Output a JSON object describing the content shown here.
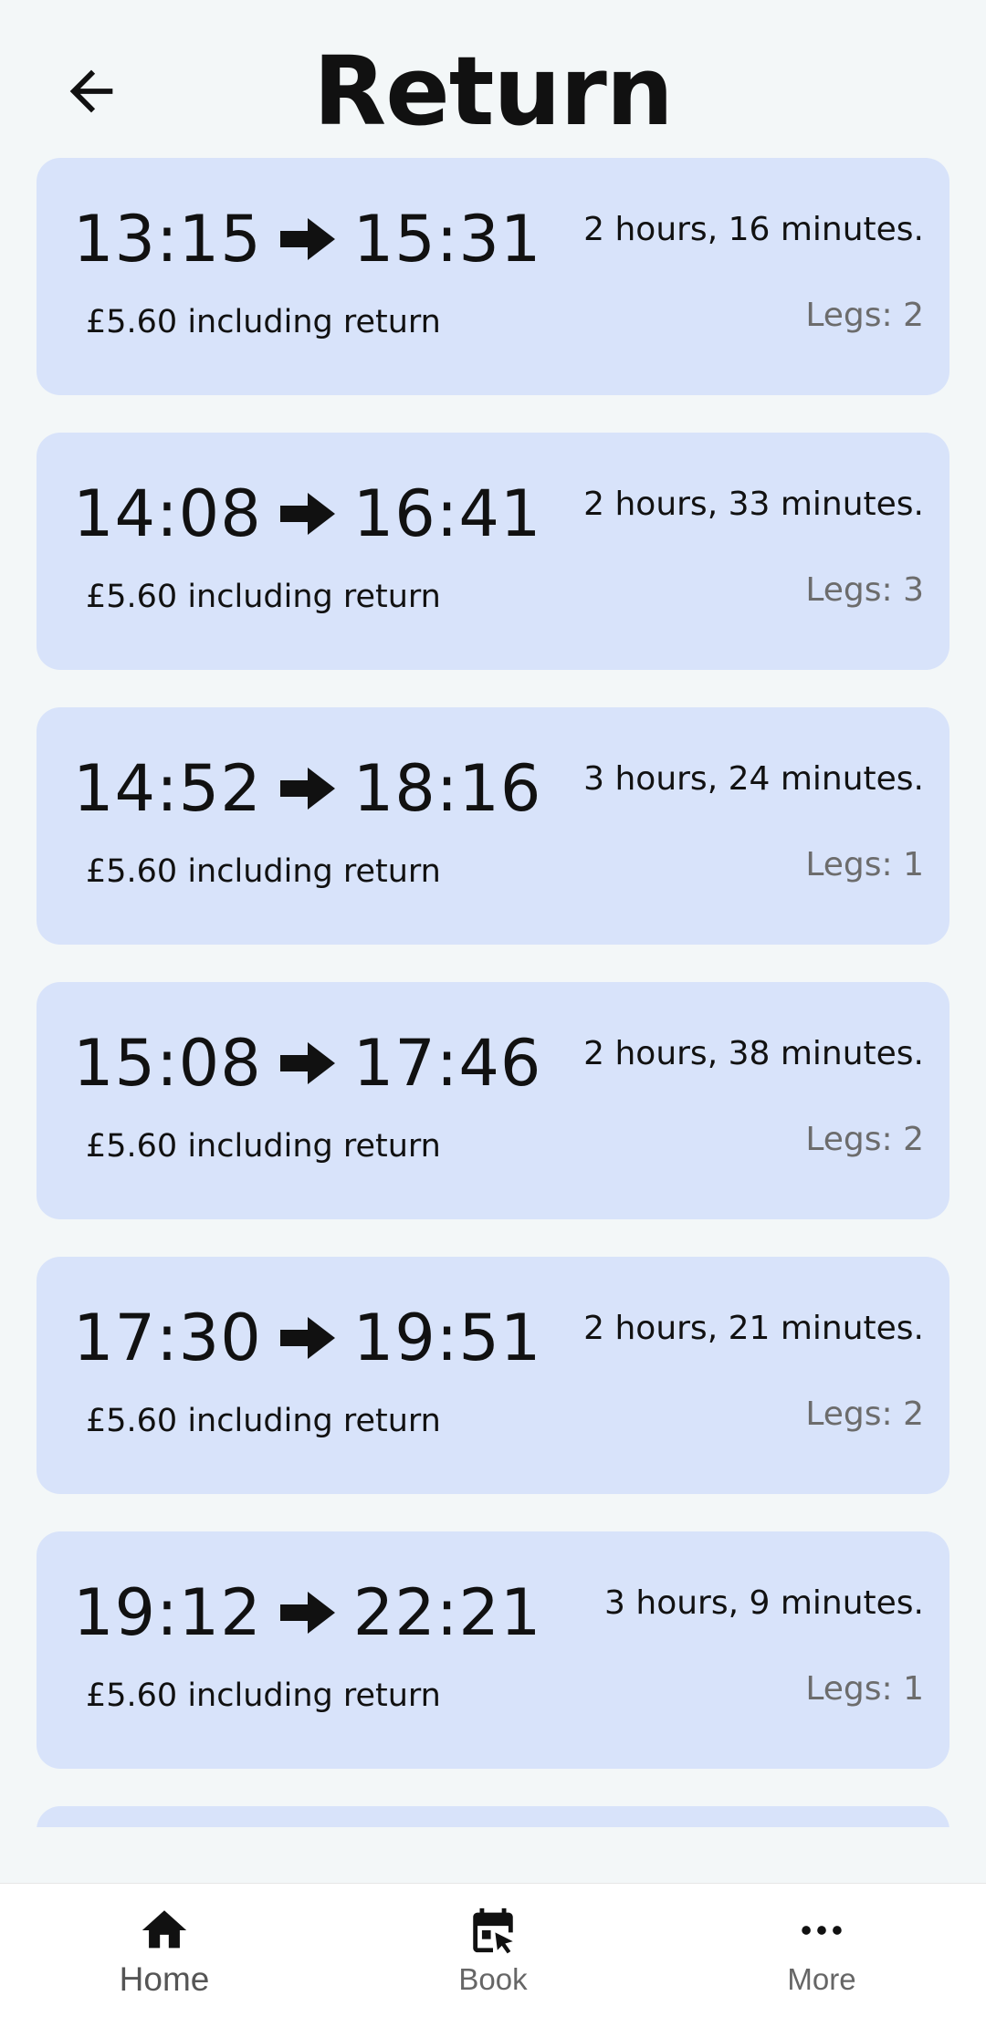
{
  "header": {
    "title": "Return",
    "back_icon": "arrow-left-icon"
  },
  "journeys": [
    {
      "depart": "13:15",
      "arrive": "15:31",
      "duration": "2 hours, 16 minutes.",
      "price": "£5.60 including return",
      "legs": "Legs: 2"
    },
    {
      "depart": "14:08",
      "arrive": "16:41",
      "duration": "2 hours, 33 minutes.",
      "price": "£5.60 including return",
      "legs": "Legs: 3"
    },
    {
      "depart": "14:52",
      "arrive": "18:16",
      "duration": "3 hours, 24 minutes.",
      "price": "£5.60 including return",
      "legs": "Legs: 1"
    },
    {
      "depart": "15:08",
      "arrive": "17:46",
      "duration": "2 hours, 38 minutes.",
      "price": "£5.60 including return",
      "legs": "Legs: 2"
    },
    {
      "depart": "17:30",
      "arrive": "19:51",
      "duration": "2 hours, 21 minutes.",
      "price": "£5.60 including return",
      "legs": "Legs: 2"
    },
    {
      "depart": "19:12",
      "arrive": "22:21",
      "duration": "3 hours, 9 minutes.",
      "price": "£5.60 including return",
      "legs": "Legs: 1"
    }
  ],
  "bottom_nav": {
    "items": [
      {
        "label": "Home",
        "icon": "home-icon",
        "active": true
      },
      {
        "label": "Book",
        "icon": "calendar-icon",
        "active": false
      },
      {
        "label": "More",
        "icon": "more-dots-icon",
        "active": false
      }
    ]
  },
  "colors": {
    "background": "#f3f7f8",
    "card": "#d8e3fa",
    "muted_text": "#6c6c6c"
  }
}
